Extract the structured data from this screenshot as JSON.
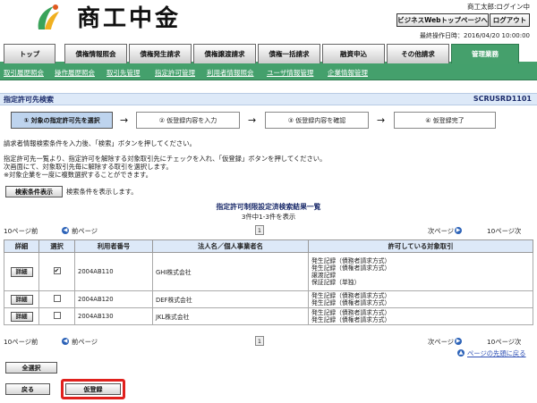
{
  "header": {
    "logo_text": "商工中金",
    "user_name": "商工太郎:ログイン中",
    "biz_top_button": "ビジネスWebトップページへ",
    "logout_button": "ログアウト",
    "last_login": "最終操作日時：2016/04/20 10:00:00"
  },
  "tabs": [
    "トップ",
    "債権情報照会",
    "債権発生請求",
    "債権譲渡請求",
    "債権一括請求",
    "融資申込",
    "その他請求",
    "管理業務"
  ],
  "subnav": [
    "取引履歴照会",
    "操作履歴照会",
    "取引先管理",
    "指定許可管理",
    "利用者情報照会",
    "ユーザ情報管理",
    "企業情報管理"
  ],
  "page": {
    "title": "指定許可先検索",
    "screen_id": "SCRUSRD1101"
  },
  "steps": [
    "① 対象の指定許可先を選択",
    "② 仮登録内容を入力",
    "③ 仮登録内容を確認",
    "④ 仮登録完了"
  ],
  "instructions": {
    "line1": "請求者情報検索条件を入力後、「検索」ボタンを押してください。",
    "line2": "指定許可先一覧より、指定許可を解除する対象取引先にチェックを入れ、「仮登録」ボタンを押してください。",
    "line3": "次画面にて、対象取引先毎に解除する取引を選択します。",
    "line4": "※対象企業を一度に複数選択することができます。"
  },
  "search": {
    "button": "検索条件表示",
    "note": "検索条件を表示します。"
  },
  "results": {
    "title": "指定許可制限設定済検索結果一覧",
    "count": "3件中1-3件を表示",
    "per_page": "10ページ前",
    "prev": "前ページ",
    "page_num": "1",
    "next": "次ページ",
    "next10": "10ページ次",
    "columns": [
      "詳細",
      "選択",
      "利用者番号",
      "法人名／個人事業者名",
      "許可している対象取引"
    ],
    "rows": [
      {
        "detail": "詳細",
        "checked": true,
        "user_no": "2004AB110",
        "name": "GHI株式会社",
        "permits": [
          "発生記録（債務者請求方式）",
          "発生記録（債権者請求方式）",
          "譲渡記録",
          "保証記録（単独）"
        ]
      },
      {
        "detail": "詳細",
        "checked": false,
        "user_no": "2004AB120",
        "name": "DEF株式会社",
        "permits": [
          "発生記録（債務者請求方式）",
          "発生記録（債権者請求方式）"
        ]
      },
      {
        "detail": "詳細",
        "checked": false,
        "user_no": "2004AB130",
        "name": "JKL株式会社",
        "permits": [
          "発生記録（債務者請求方式）",
          "発生記録（債権者請求方式）"
        ]
      }
    ]
  },
  "bottom": {
    "back_to_top": "ページの先頭に戻る",
    "select_all": "全選択",
    "back": "戻る",
    "register": "仮登録"
  },
  "colors": {
    "accent_green": "#45a06c",
    "title_navy": "#1b2b6b",
    "highlight_red": "#e0211d",
    "header_blue": "#dde9f8"
  }
}
